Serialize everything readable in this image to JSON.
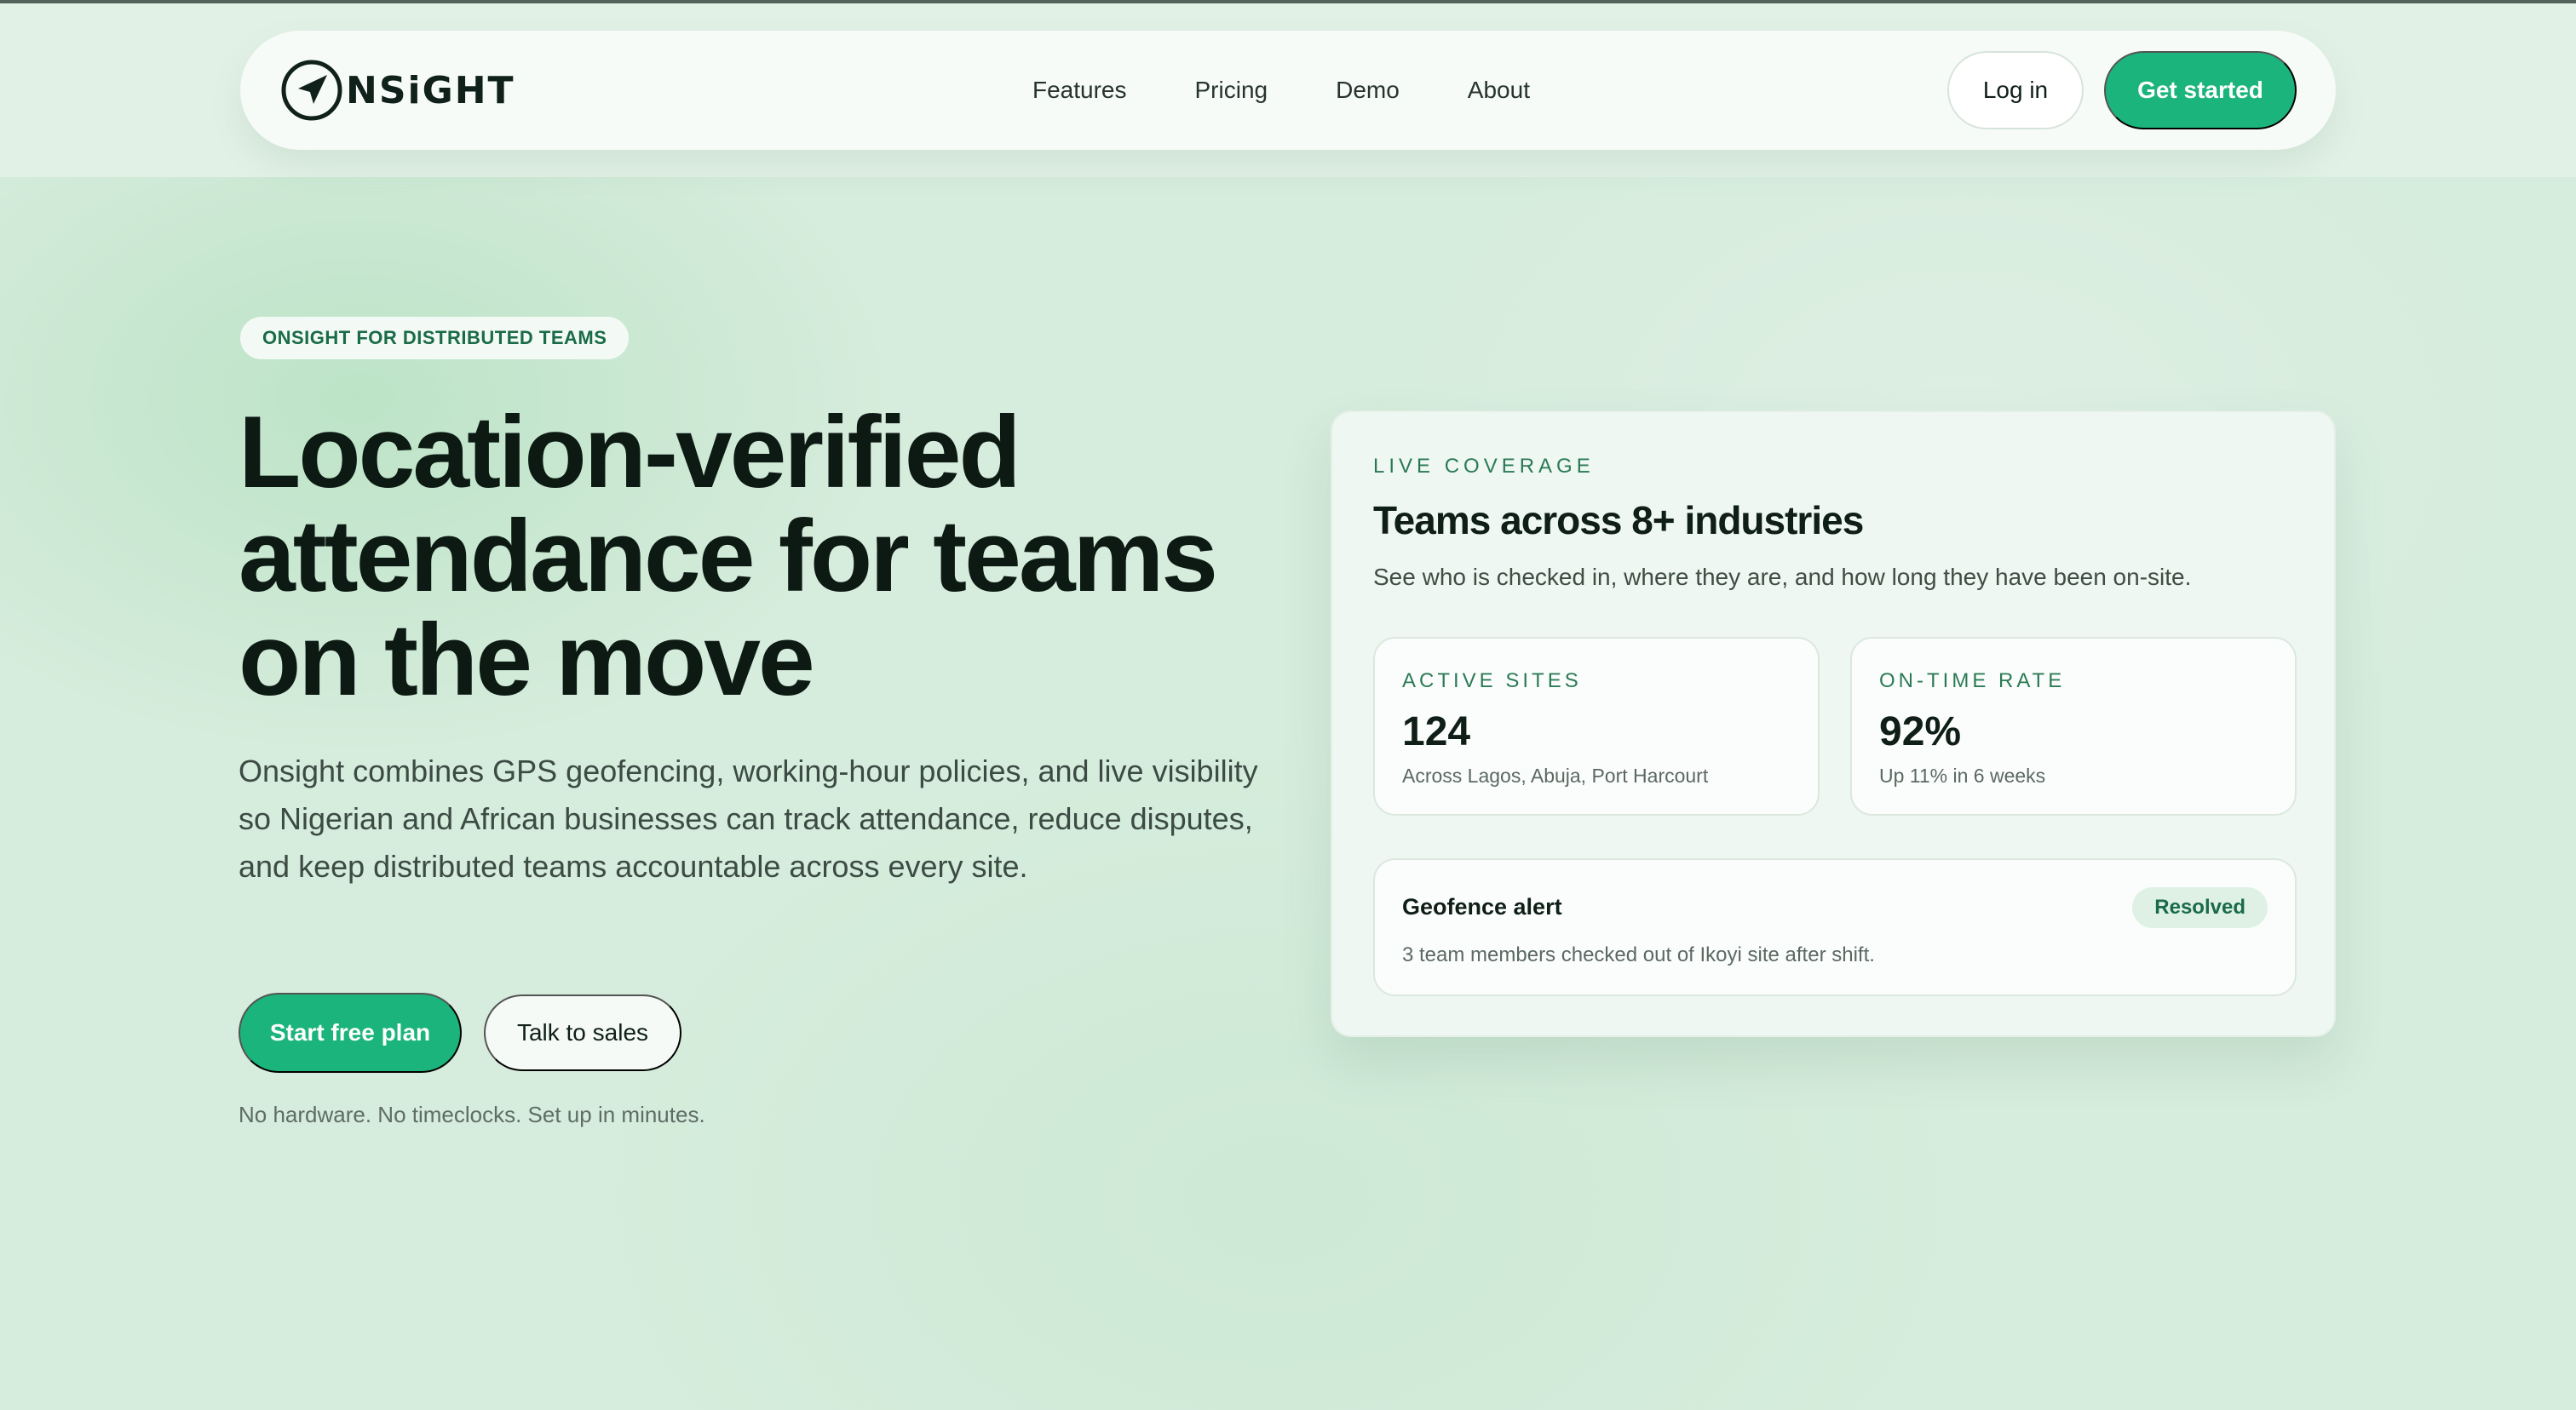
{
  "brand": {
    "name": "NSiGHT"
  },
  "nav": {
    "links": [
      "Features",
      "Pricing",
      "Demo",
      "About"
    ],
    "login_label": "Log in",
    "cta_label": "Get started"
  },
  "hero": {
    "eyebrow": "ONSIGHT FOR DISTRIBUTED TEAMS",
    "headline": "Location-verified attendance for teams on the move",
    "lead": "Onsight combines GPS geofencing, working-hour policies, and live visibility so Nigerian and African businesses can track attendance, reduce disputes, and keep distributed teams accountable across every site.",
    "primary_cta": "Start free plan",
    "secondary_cta": "Talk to sales",
    "footnote": "No hardware. No timeclocks. Set up in minutes."
  },
  "coverage": {
    "eyebrow": "LIVE COVERAGE",
    "title": "Teams across 8+ industries",
    "subtitle": "See who is checked in, where they are, and how long they have been on-site.",
    "stats": [
      {
        "label": "ACTIVE SITES",
        "value": "124",
        "note": "Across Lagos, Abuja, Port Harcourt"
      },
      {
        "label": "ON-TIME RATE",
        "value": "92%",
        "note": "Up 11% in 6 weeks"
      }
    ],
    "alert": {
      "title": "Geofence alert",
      "badge": "Resolved",
      "text": "3 team members checked out of Ikoyi site after shift."
    }
  },
  "colors": {
    "accent": "#1bb47c",
    "accent_text": "#2b7a55",
    "background": "#d6ecdc",
    "ink": "#0f1f17"
  },
  "icons": {
    "logo": "navigation-arrow-icon"
  }
}
